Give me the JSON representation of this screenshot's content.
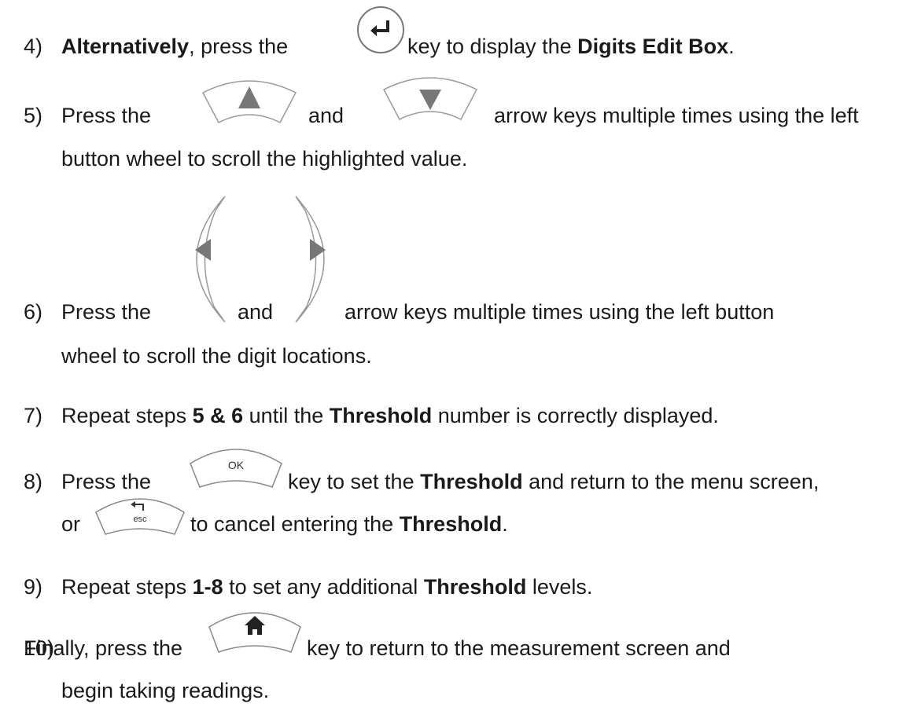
{
  "steps": [
    {
      "num": "4)",
      "a": "Alternatively",
      "b": ", press the ",
      "c": " key to display the ",
      "d": "Digits Edit Box",
      "e": "."
    },
    {
      "num": "5)",
      "a": "Press the ",
      "b": " and ",
      "c": " arrow keys multiple times using the left",
      "d": "button wheel to scroll the highlighted value."
    },
    {
      "num": "6)",
      "a": "Press the ",
      "b": " and ",
      "c": " arrow keys multiple times using the left button",
      "d": "wheel to scroll the digit locations."
    },
    {
      "num": "7)",
      "a": "Repeat steps ",
      "b": "5 & 6",
      "c": " until the ",
      "d": "Threshold",
      "e": " number is correctly displayed."
    },
    {
      "num": "8)",
      "a": "Press the ",
      "b": " key to set the ",
      "c": "Threshold",
      "d": " and return to the menu screen,",
      "e": "or ",
      "f": " to cancel entering the ",
      "g": "Threshold",
      "h": "."
    },
    {
      "num": "9)",
      "a": "Repeat steps ",
      "b": "1-8",
      "c": " to set any additional ",
      "d": "Threshold",
      "e": " levels."
    },
    {
      "num": "10)",
      "a": "Finally, press the ",
      "b": " key to return to the measurement screen and",
      "c": "begin taking readings."
    }
  ],
  "keys": {
    "enter_icon": "enter-key-icon",
    "up_icon": "up-arrow-key-icon",
    "down_icon": "down-arrow-key-icon",
    "left_icon": "left-arrow-key-icon",
    "right_icon": "right-arrow-key-icon",
    "ok_label": "OK",
    "esc_label": "esc",
    "home_icon": "home-key-icon"
  }
}
